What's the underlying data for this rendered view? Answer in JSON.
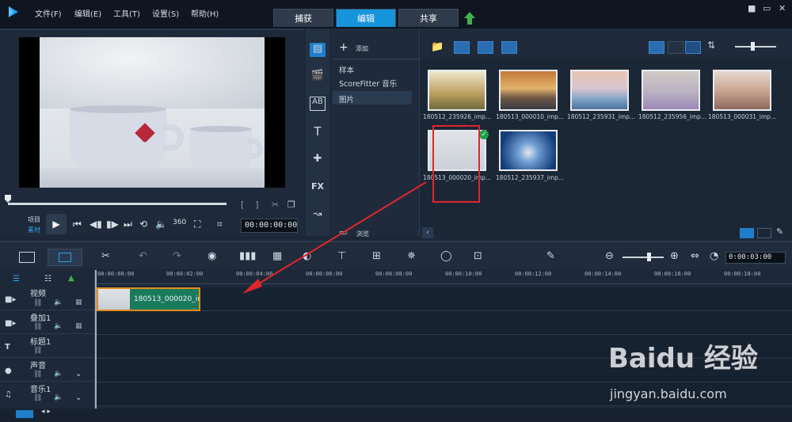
{
  "menu": [
    "文件(F)",
    "编辑(E)",
    "工具(T)",
    "设置(S)",
    "帮助(H)"
  ],
  "mode_tabs": [
    "捕获",
    "编辑",
    "共享"
  ],
  "window_controls": [
    "■",
    "▭",
    "✕"
  ],
  "preview": {
    "project_label": "项目",
    "clip_label": "素材",
    "timecode": "00:00:00:00"
  },
  "library": {
    "add_label": "添加",
    "items": [
      "样本",
      "ScoreFitter 音乐",
      "图片"
    ],
    "browse_label": "浏览"
  },
  "thumbnails": [
    "180512_235926_imp...",
    "180513_000010_imp...",
    "180512_235931_imp...",
    "180512_235956_imp...",
    "180513_000031_imp...",
    "180513_000020_imp...",
    "180512_235937_imp..."
  ],
  "timeline": {
    "timecode": "0:00:03:00",
    "ruler": [
      "00:00:00:00",
      "00:00:02:00",
      "00:00:04:00",
      "00:00:06:00",
      "00:00:08:00",
      "00:00:10:00",
      "00:00:12:00",
      "00:00:14:00",
      "00:00:16:00",
      "00:00:18:00"
    ],
    "tracks": [
      "视频",
      "叠加1",
      "标题1",
      "声音",
      "音乐1"
    ],
    "clip_label": "180513_000020_im"
  },
  "watermark": {
    "main": "Baidu 经验",
    "sub": "jingyan.baidu.com"
  },
  "colors": {
    "accent": "#1795dc",
    "highlight_box": "#e0262b",
    "clip": "#1a7a5c",
    "clip_border": "#e38d1b"
  }
}
